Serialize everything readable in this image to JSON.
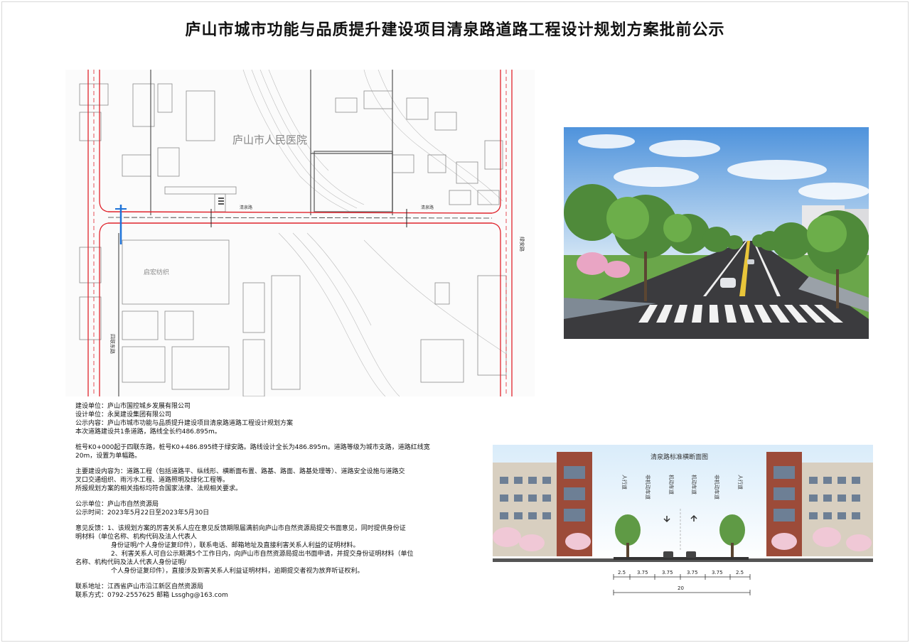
{
  "title": "庐山市城市功能与品质提升建设项目清泉路道路工程设计规划方案批前公示",
  "map": {
    "hospital": "庐山市人民医院",
    "qingquan_road_1": "清泉路",
    "qingquan_road_2": "清泉路",
    "qiyuan_factory": "启宏纺织",
    "lianan_road": "绿安路",
    "silian_east_road": "四联东路"
  },
  "section": {
    "title": "清泉路标准横断面图",
    "lanes": [
      "人行道",
      "非机动车道",
      "机动车道",
      "机动车道",
      "非机动车道",
      "人行道"
    ],
    "widths": [
      "2.5",
      "3.75",
      "3.75",
      "3.75",
      "3.75",
      "2.5"
    ],
    "total": "20"
  },
  "notice": {
    "builder": "建设单位：庐山市国控城乡发展有限公司",
    "designer": "设计单位：永昊建设集团有限公司",
    "content": "公示内容：庐山市城市功能与品质提升建设项目清泉路道路工程设计规划方案",
    "summary": "本次道路建设共1条道路，路线全长约486.895m。",
    "route_1": "桩号K0+000起于四联东路，桩号K0+486.895终于绿安路。路线设计全长为486.895m。道路等级为城市支路，道路红线宽",
    "route_2": "20m，设置为单幅路。",
    "main_1": "主要建设内容为：道路工程（包括道路平、纵线形、横断面布置、路基、路面、路基处理等）、道路安全设施与道路交",
    "main_2": "叉口交通组织、雨污水工程、道路照明及绿化工程等。",
    "main_3": "所报规划方案的相关指标均符合国家法律、法规相关要求。",
    "publisher": "公示单位：庐山市自然资源局",
    "period": "公示时间：2023年5月22日至2023年5月30日",
    "feedback_1": "意见反馈：1、该规划方案的厉害关系人应在意见反馈期限届满前向庐山市自然资源局提交书面意见，同时提供身份证",
    "feedback_2": "明材料（单位名称、机构代码及法人代表人",
    "feedback_3": "身份证明/个人身份证复印件），联系电话、邮箱地址及直接利害关系人利益的证明材料。",
    "feedback_4": "2、利害关系人可自公示期满5个工作日内，向庐山市自然资源局提出书面申请，并提交身份证明材料（单位",
    "feedback_5": "名称、机构代码及法人代表人身份证明/",
    "feedback_6": "个人身份证复印件），直接涉及到害关系人利益证明材料，逾期提交者视为放弃听证权利。",
    "address": "联系地址：江西省庐山市沿江新区自然资源局",
    "contact": "联系方式：0792-2557625      邮箱        Lssghg@163.com"
  },
  "colors": {
    "road_red": "#e0242c",
    "sky": "#5a9de0",
    "asphalt": "#3b3b3e"
  }
}
